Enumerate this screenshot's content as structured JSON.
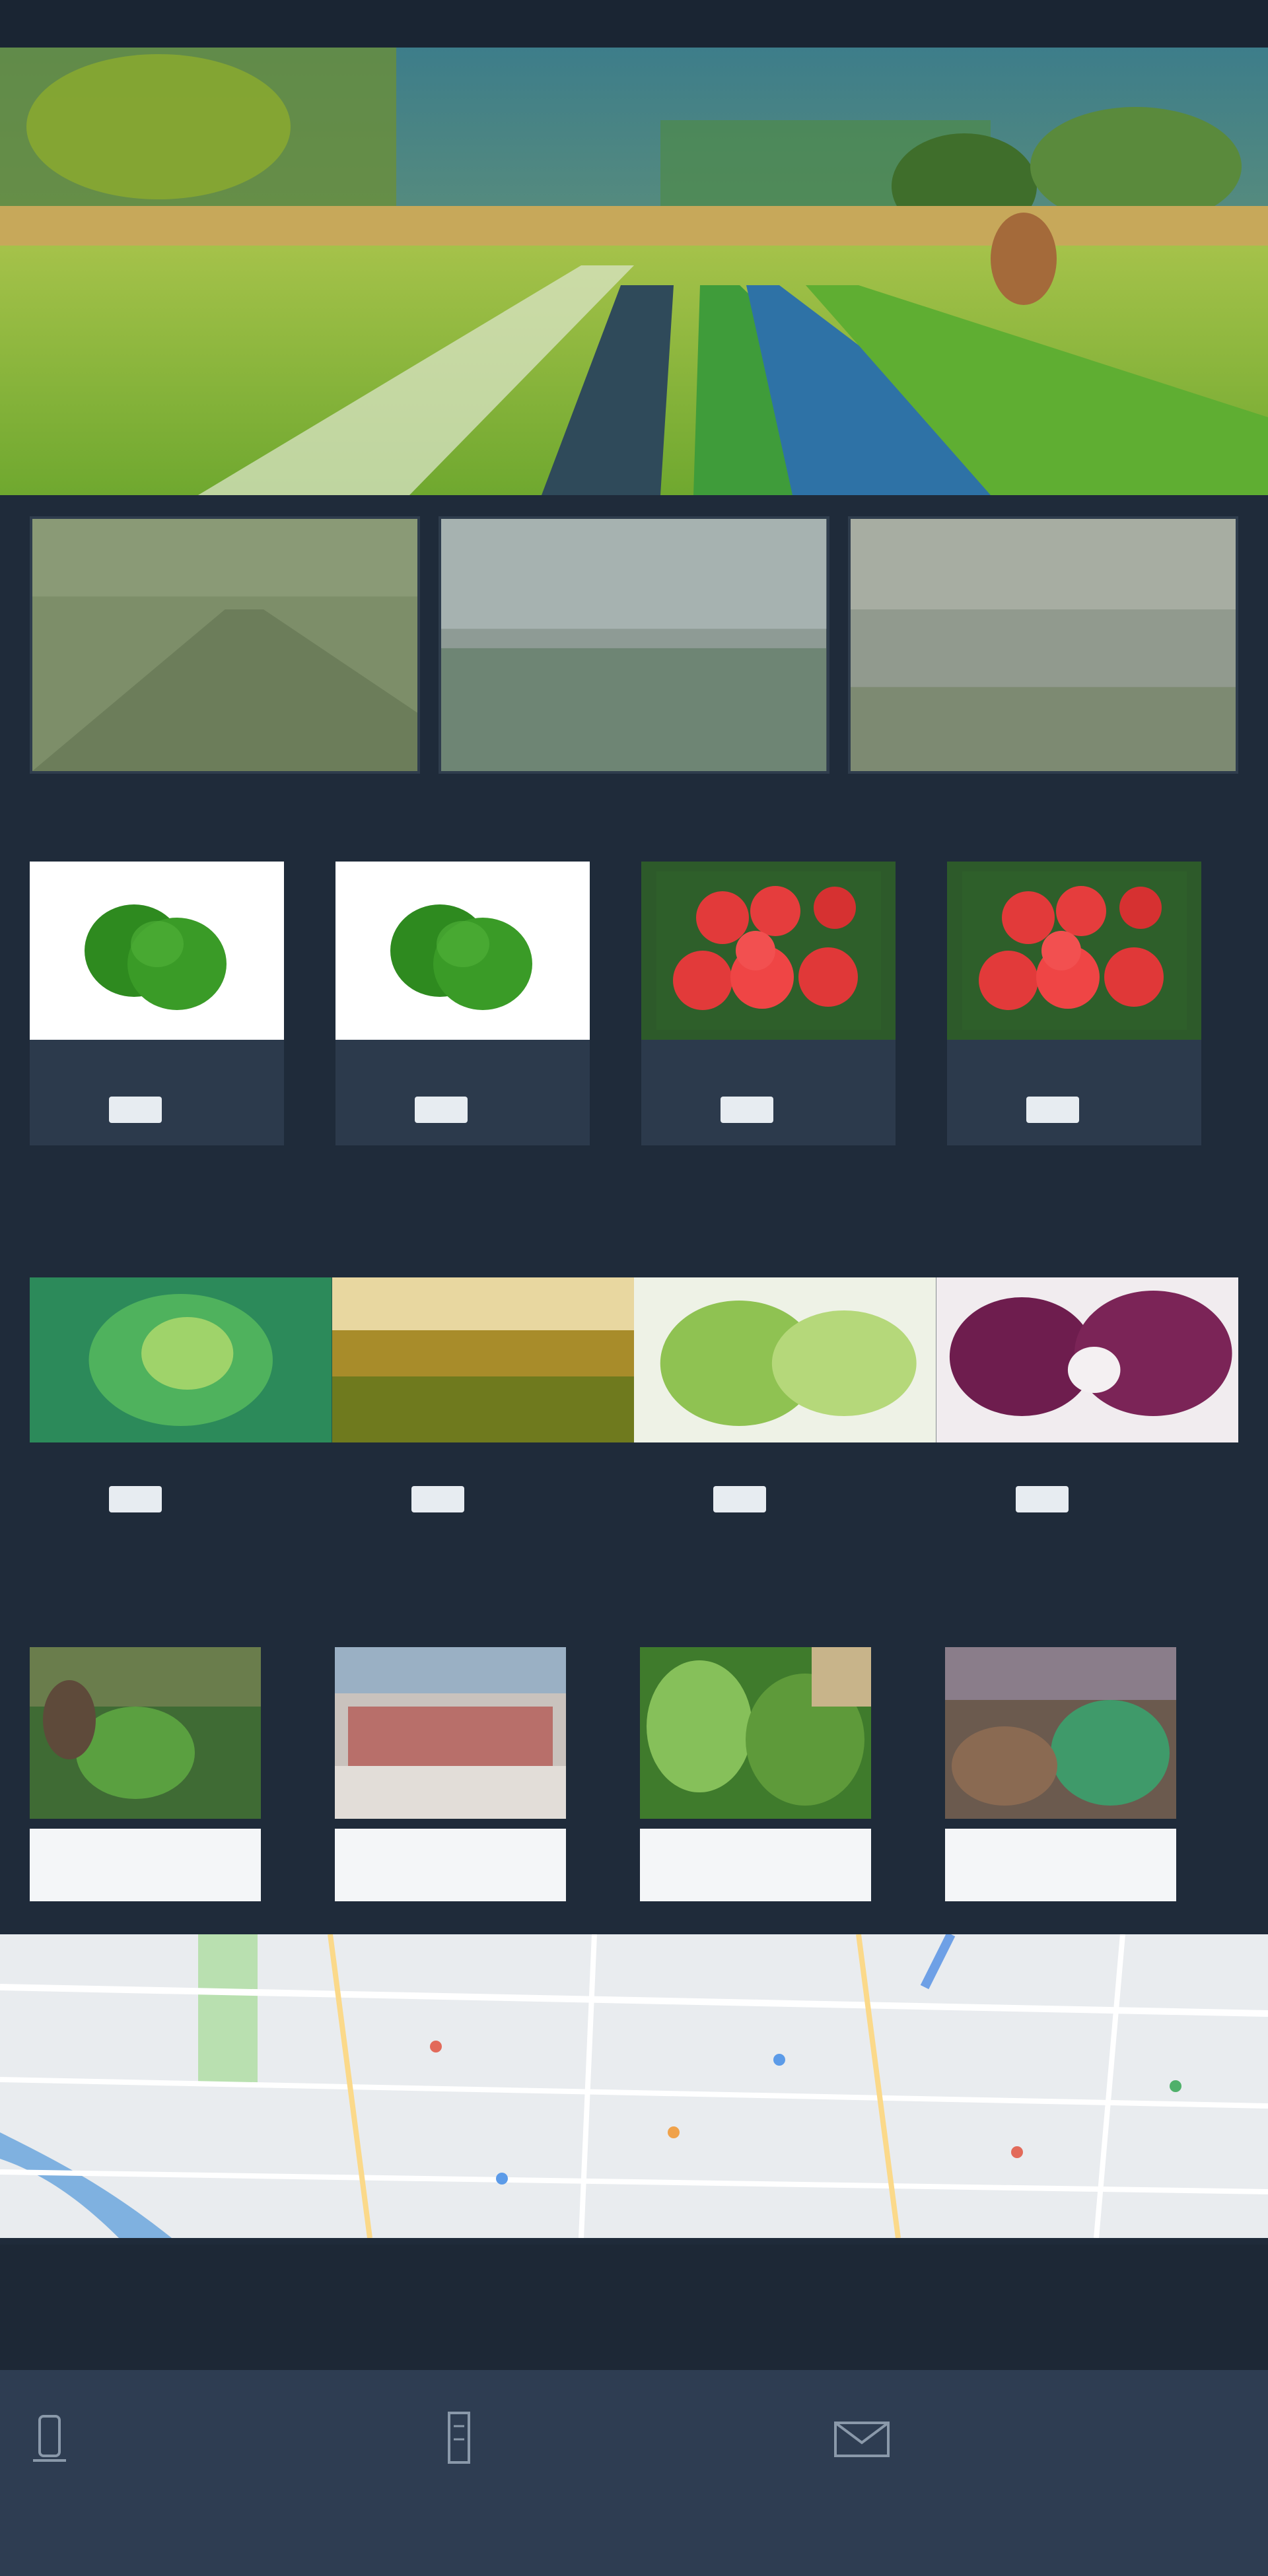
{
  "header": {
    "logo": "",
    "nav": [
      "",
      "",
      "",
      "",
      "",
      ""
    ],
    "right": ""
  },
  "sections": {
    "products_title": "",
    "products_more": "",
    "featured_more": "",
    "news_title": "",
    "news_more": ""
  },
  "products": [
    {
      "name": "",
      "price": "",
      "unit": "",
      "buy": "",
      "image": "green-vegetable"
    },
    {
      "name": "",
      "price": "",
      "unit": "",
      "buy": "",
      "image": "green-vegetable"
    },
    {
      "name": "",
      "price": "",
      "unit": "",
      "buy": "",
      "image": "red-tomatoes"
    },
    {
      "name": "",
      "price": "",
      "unit": "",
      "buy": "",
      "image": "red-tomatoes"
    }
  ],
  "featured": [
    {
      "name": "",
      "price": "",
      "buy": "",
      "image": "green-cabbage"
    },
    {
      "name": "",
      "price": "",
      "buy": "",
      "image": "wheat-field"
    },
    {
      "name": "",
      "price": "",
      "buy": "",
      "image": "lettuce"
    },
    {
      "name": "",
      "price": "",
      "buy": "",
      "image": "red-onion"
    }
  ],
  "news": [
    {
      "caption": "",
      "image": "farm-worker"
    },
    {
      "caption": "",
      "image": "market"
    },
    {
      "caption": "",
      "image": "greenhouse-crops"
    },
    {
      "caption": "",
      "image": "field-harvest"
    }
  ],
  "footer": {
    "col1": "",
    "col2": "",
    "col3": "",
    "copyright": "",
    "right": ""
  },
  "colors": {
    "background": "#1f2b3a",
    "card": "#2c3a4c",
    "price": "#d9a441",
    "more_link": "#c9544f",
    "footer": "#2e3d52"
  }
}
